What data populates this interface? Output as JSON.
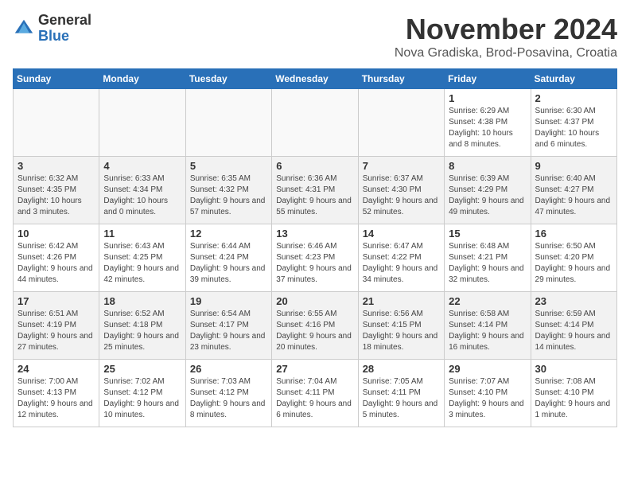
{
  "header": {
    "logo_general": "General",
    "logo_blue": "Blue",
    "month_title": "November 2024",
    "location": "Nova Gradiska, Brod-Posavina, Croatia"
  },
  "weekdays": [
    "Sunday",
    "Monday",
    "Tuesday",
    "Wednesday",
    "Thursday",
    "Friday",
    "Saturday"
  ],
  "weeks": [
    [
      {
        "day": "",
        "info": ""
      },
      {
        "day": "",
        "info": ""
      },
      {
        "day": "",
        "info": ""
      },
      {
        "day": "",
        "info": ""
      },
      {
        "day": "",
        "info": ""
      },
      {
        "day": "1",
        "info": "Sunrise: 6:29 AM\nSunset: 4:38 PM\nDaylight: 10 hours and 8 minutes."
      },
      {
        "day": "2",
        "info": "Sunrise: 6:30 AM\nSunset: 4:37 PM\nDaylight: 10 hours and 6 minutes."
      }
    ],
    [
      {
        "day": "3",
        "info": "Sunrise: 6:32 AM\nSunset: 4:35 PM\nDaylight: 10 hours and 3 minutes."
      },
      {
        "day": "4",
        "info": "Sunrise: 6:33 AM\nSunset: 4:34 PM\nDaylight: 10 hours and 0 minutes."
      },
      {
        "day": "5",
        "info": "Sunrise: 6:35 AM\nSunset: 4:32 PM\nDaylight: 9 hours and 57 minutes."
      },
      {
        "day": "6",
        "info": "Sunrise: 6:36 AM\nSunset: 4:31 PM\nDaylight: 9 hours and 55 minutes."
      },
      {
        "day": "7",
        "info": "Sunrise: 6:37 AM\nSunset: 4:30 PM\nDaylight: 9 hours and 52 minutes."
      },
      {
        "day": "8",
        "info": "Sunrise: 6:39 AM\nSunset: 4:29 PM\nDaylight: 9 hours and 49 minutes."
      },
      {
        "day": "9",
        "info": "Sunrise: 6:40 AM\nSunset: 4:27 PM\nDaylight: 9 hours and 47 minutes."
      }
    ],
    [
      {
        "day": "10",
        "info": "Sunrise: 6:42 AM\nSunset: 4:26 PM\nDaylight: 9 hours and 44 minutes."
      },
      {
        "day": "11",
        "info": "Sunrise: 6:43 AM\nSunset: 4:25 PM\nDaylight: 9 hours and 42 minutes."
      },
      {
        "day": "12",
        "info": "Sunrise: 6:44 AM\nSunset: 4:24 PM\nDaylight: 9 hours and 39 minutes."
      },
      {
        "day": "13",
        "info": "Sunrise: 6:46 AM\nSunset: 4:23 PM\nDaylight: 9 hours and 37 minutes."
      },
      {
        "day": "14",
        "info": "Sunrise: 6:47 AM\nSunset: 4:22 PM\nDaylight: 9 hours and 34 minutes."
      },
      {
        "day": "15",
        "info": "Sunrise: 6:48 AM\nSunset: 4:21 PM\nDaylight: 9 hours and 32 minutes."
      },
      {
        "day": "16",
        "info": "Sunrise: 6:50 AM\nSunset: 4:20 PM\nDaylight: 9 hours and 29 minutes."
      }
    ],
    [
      {
        "day": "17",
        "info": "Sunrise: 6:51 AM\nSunset: 4:19 PM\nDaylight: 9 hours and 27 minutes."
      },
      {
        "day": "18",
        "info": "Sunrise: 6:52 AM\nSunset: 4:18 PM\nDaylight: 9 hours and 25 minutes."
      },
      {
        "day": "19",
        "info": "Sunrise: 6:54 AM\nSunset: 4:17 PM\nDaylight: 9 hours and 23 minutes."
      },
      {
        "day": "20",
        "info": "Sunrise: 6:55 AM\nSunset: 4:16 PM\nDaylight: 9 hours and 20 minutes."
      },
      {
        "day": "21",
        "info": "Sunrise: 6:56 AM\nSunset: 4:15 PM\nDaylight: 9 hours and 18 minutes."
      },
      {
        "day": "22",
        "info": "Sunrise: 6:58 AM\nSunset: 4:14 PM\nDaylight: 9 hours and 16 minutes."
      },
      {
        "day": "23",
        "info": "Sunrise: 6:59 AM\nSunset: 4:14 PM\nDaylight: 9 hours and 14 minutes."
      }
    ],
    [
      {
        "day": "24",
        "info": "Sunrise: 7:00 AM\nSunset: 4:13 PM\nDaylight: 9 hours and 12 minutes."
      },
      {
        "day": "25",
        "info": "Sunrise: 7:02 AM\nSunset: 4:12 PM\nDaylight: 9 hours and 10 minutes."
      },
      {
        "day": "26",
        "info": "Sunrise: 7:03 AM\nSunset: 4:12 PM\nDaylight: 9 hours and 8 minutes."
      },
      {
        "day": "27",
        "info": "Sunrise: 7:04 AM\nSunset: 4:11 PM\nDaylight: 9 hours and 6 minutes."
      },
      {
        "day": "28",
        "info": "Sunrise: 7:05 AM\nSunset: 4:11 PM\nDaylight: 9 hours and 5 minutes."
      },
      {
        "day": "29",
        "info": "Sunrise: 7:07 AM\nSunset: 4:10 PM\nDaylight: 9 hours and 3 minutes."
      },
      {
        "day": "30",
        "info": "Sunrise: 7:08 AM\nSunset: 4:10 PM\nDaylight: 9 hours and 1 minute."
      }
    ]
  ]
}
